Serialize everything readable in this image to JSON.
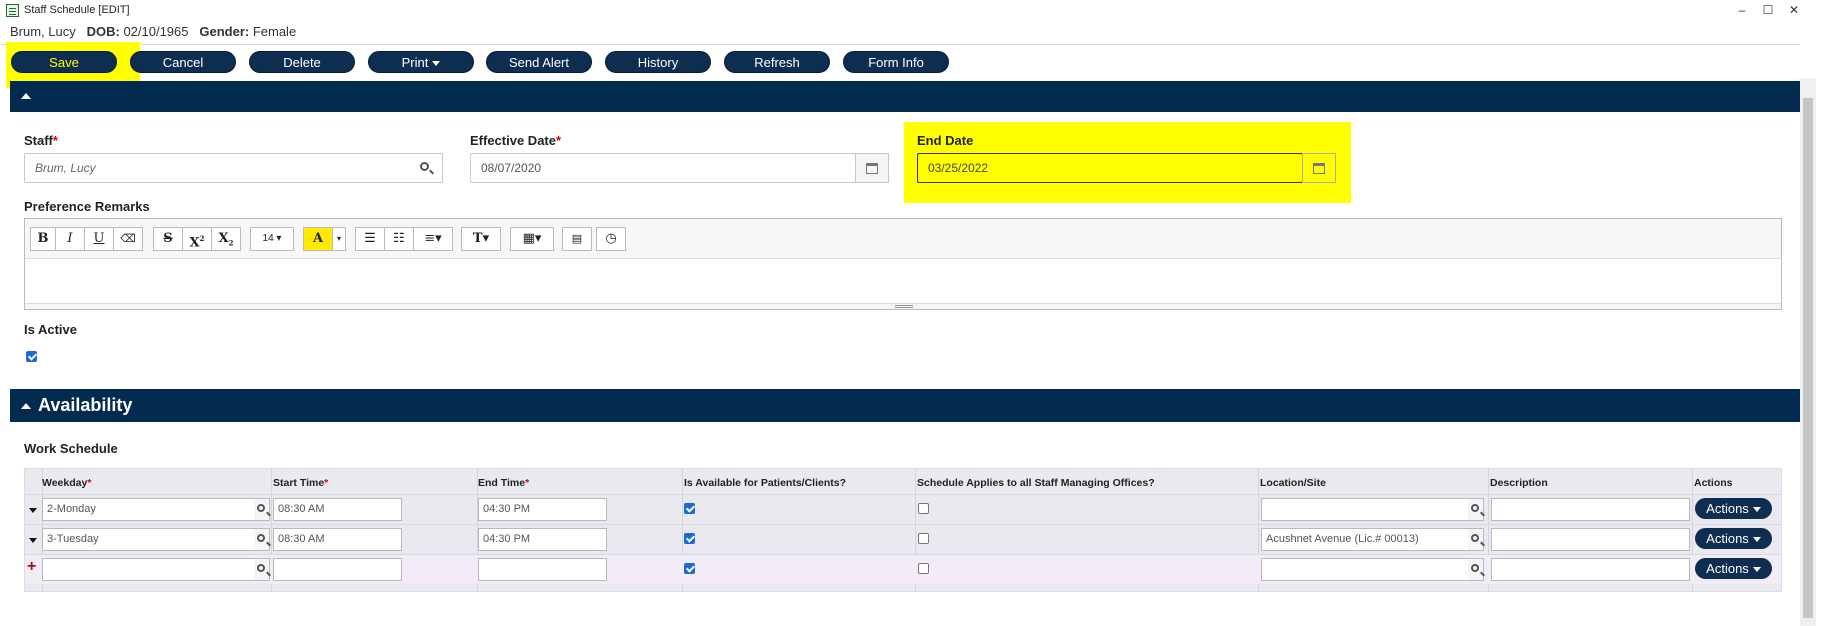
{
  "window": {
    "title": "Staff Schedule [EDIT]",
    "controls": [
      "–",
      "☐",
      "✕"
    ]
  },
  "patient": {
    "name": "Brum, Lucy",
    "dob_label": "DOB:",
    "dob": "02/10/1965",
    "gender_label": "Gender:",
    "gender": "Female"
  },
  "toolbar": {
    "save": "Save",
    "cancel": "Cancel",
    "delete": "Delete",
    "print": "Print",
    "send_alert": "Send Alert",
    "history": "History",
    "refresh": "Refresh",
    "form_info": "Form Info"
  },
  "form": {
    "staff_label": "Staff",
    "staff_value": "Brum, Lucy",
    "effective_label": "Effective Date",
    "effective_value": "08/07/2020",
    "end_label": "End Date",
    "end_value": "03/25/2022",
    "remarks_label": "Preference Remarks",
    "font_size": "14",
    "active_label": "Is Active",
    "is_active": true,
    "required_mark": "*"
  },
  "availability": {
    "title": "Availability",
    "work_schedule_label": "Work Schedule",
    "columns": {
      "weekday": "Weekday",
      "start": "Start Time",
      "end": "End Time",
      "available": "Is Available for Patients/Clients?",
      "applies": "Schedule Applies to all Staff Managing Offices?",
      "location": "Location/Site",
      "description": "Description",
      "actions": "Actions"
    },
    "rows": [
      {
        "weekday": "2-Monday",
        "start": "08:30 AM",
        "end": "04:30 PM",
        "available": true,
        "applies": false,
        "location": "",
        "description": "",
        "actions": "Actions"
      },
      {
        "weekday": "3-Tuesday",
        "start": "08:30 AM",
        "end": "04:30 PM",
        "available": true,
        "applies": false,
        "location": "Acushnet Avenue (Lic.# 00013)",
        "description": "",
        "actions": "Actions"
      },
      {
        "weekday": "",
        "start": "",
        "end": "",
        "available": true,
        "applies": false,
        "location": "",
        "description": "",
        "actions": "Actions"
      }
    ]
  },
  "colors": {
    "navy": "#032b50",
    "button": "#0d2e50",
    "highlight": "#ffff00",
    "required": "#dd0000"
  }
}
